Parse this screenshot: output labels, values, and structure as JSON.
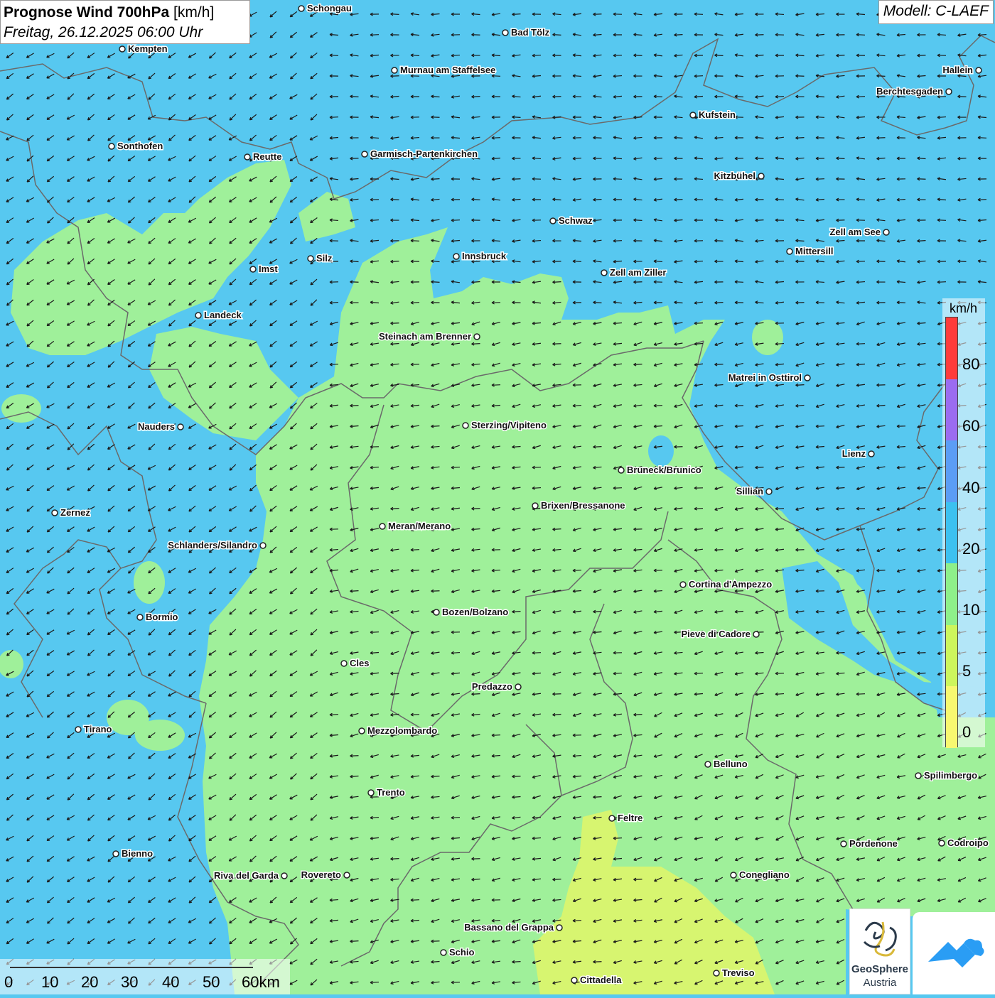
{
  "header": {
    "title_bold": "Prognose Wind 700hPa",
    "title_unit": "[km/h]",
    "datetime": "Freitag, 26.12.2025 06:00 Uhr",
    "model": "Modell: C-LAEF"
  },
  "legend": {
    "unit": "km/h",
    "ticks": [
      "80",
      "60",
      "40",
      "20",
      "10",
      "5",
      "0"
    ],
    "colors": [
      "#ff3b3b",
      "#9b6cf0",
      "#5b9df5",
      "#3cc1f0",
      "#8ef08a",
      "#cdf65c",
      "#f8f870"
    ]
  },
  "scale_bar": {
    "labels": [
      "0",
      "10",
      "20",
      "30",
      "40",
      "50",
      "60km"
    ]
  },
  "colors": {
    "wind_10_20": "#57c8f0",
    "wind_5_10": "#9ff09a",
    "wind_0_5": "#d7f570",
    "border": "#6a6a6a",
    "arrow": "#1a1a1a"
  },
  "cities": [
    {
      "name": "Schongau"
    },
    {
      "name": "Bad Tölz"
    },
    {
      "name": "Kempten"
    },
    {
      "name": "Murnau am Staffelsee"
    },
    {
      "name": "Hallein"
    },
    {
      "name": "Berchtesgaden"
    },
    {
      "name": "Kufstein"
    },
    {
      "name": "Sonthofen"
    },
    {
      "name": "Reutte"
    },
    {
      "name": "Garmisch-Partenkirchen"
    },
    {
      "name": "Kitzbühel"
    },
    {
      "name": "Schwaz"
    },
    {
      "name": "Zell am See"
    },
    {
      "name": "Mittersill"
    },
    {
      "name": "Innsbruck"
    },
    {
      "name": "Silz"
    },
    {
      "name": "Imst"
    },
    {
      "name": "Zell am Ziller"
    },
    {
      "name": "Landeck"
    },
    {
      "name": "Steinach am Brenner"
    },
    {
      "name": "Matrei in Osttirol"
    },
    {
      "name": "Nauders"
    },
    {
      "name": "Sterzing/Vipiteno"
    },
    {
      "name": "Lienz"
    },
    {
      "name": "Bruneck/Brunico"
    },
    {
      "name": "Sillian"
    },
    {
      "name": "Zernez"
    },
    {
      "name": "Brixen/Bressanone"
    },
    {
      "name": "Meran/Merano"
    },
    {
      "name": "Schlanders/Silandro"
    },
    {
      "name": "Cortina d'Ampezzo"
    },
    {
      "name": "Bormio"
    },
    {
      "name": "Bozen/Bolzano"
    },
    {
      "name": "Pieve di Cadore"
    },
    {
      "name": "Cles"
    },
    {
      "name": "Predazzo"
    },
    {
      "name": "Tirano"
    },
    {
      "name": "Mezzolombardo"
    },
    {
      "name": "Belluno"
    },
    {
      "name": "Spilimbergo"
    },
    {
      "name": "Trento"
    },
    {
      "name": "Feltre"
    },
    {
      "name": "Bienno"
    },
    {
      "name": "Pordenone"
    },
    {
      "name": "Codroipo"
    },
    {
      "name": "Riva del Garda"
    },
    {
      "name": "Rovereto"
    },
    {
      "name": "Conegliano"
    },
    {
      "name": "Bassano del Grappa"
    },
    {
      "name": "Schio"
    },
    {
      "name": "Treviso"
    },
    {
      "name": "Cittadella"
    }
  ],
  "logos": {
    "geosphere_line1": "GeoSphere",
    "geosphere_line2": "Austria",
    "app_logo_icon": "mountain-cloud-icon"
  }
}
